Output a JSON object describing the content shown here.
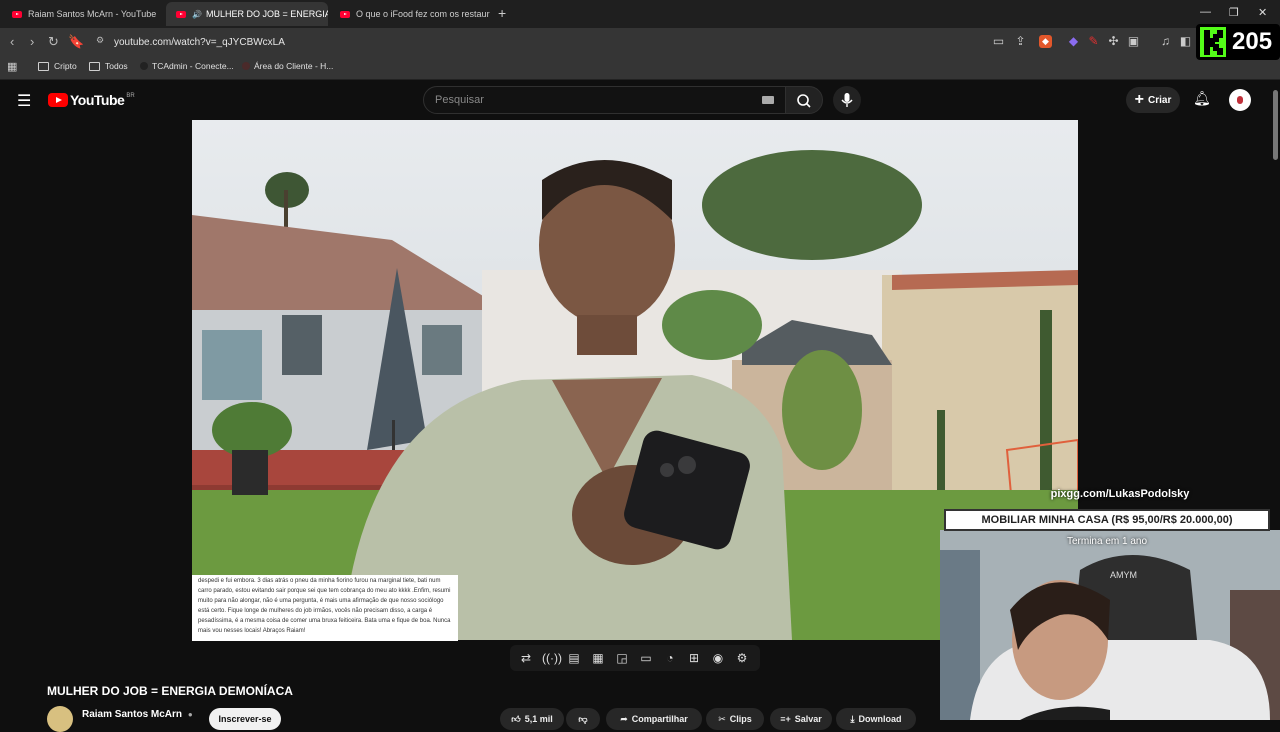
{
  "browser": {
    "tabs": [
      {
        "title": "Raiam Santos McArn - YouTube",
        "active": false
      },
      {
        "title": "MULHER DO JOB = ENERGIA",
        "active": true
      },
      {
        "title": "O que o iFood fez com os restaurante",
        "active": false
      }
    ],
    "new_tab": "+",
    "url": "youtube.com/watch?v=_qJYCBWcxLA",
    "bookmarks": [
      "Cripto",
      "Todos",
      "TCAdmin - Conecte...",
      "Área do Cliente - H..."
    ]
  },
  "youtube": {
    "logo_text": "YouTube",
    "region": "BR",
    "search_placeholder": "Pesquisar",
    "create_label": "Criar"
  },
  "video": {
    "title": "MULHER DO JOB = ENERGIA DEMONÍACA",
    "channel": "Raiam Santos McArn",
    "subscribe_label": "Inscrever-se",
    "comment_overlay": "despedi e fui embora. 3 dias atrás o pneu da minha fiorino furou na marginal tiete, bati num carro parado, estou evitando sair porque sei que tem cobrança do meu ato kkkk .Enfim, resumi muito para não alongar, não é uma pergunta, é mais uma afirmação de que nosso sociólogo está certo. Fique longe de mulheres do job irmãos, vocês não precisam disso, a carga é pesadíssima, é a mesma coisa de comer uma bruxa feiticeira. Bata uma e fique de boa. Nunca mais vou nesses locais! Abraços Raiam!",
    "actions": [
      "5,1 mil",
      "Compartilhar",
      "Clips",
      "Salvar",
      "Download"
    ]
  },
  "stream_overlay": {
    "k_count": "205",
    "pix_url": "pixgg.com/LukasPodolsky",
    "goal_text": "MOBILIAR MINHA CASA (R$ 95,00/R$ 20.000,00)",
    "goal_sub": "Termina em 1 ano"
  },
  "colors": {
    "yt_red": "#ff0000",
    "k_green": "#53fc18",
    "page_bg": "#0f0f0f"
  }
}
